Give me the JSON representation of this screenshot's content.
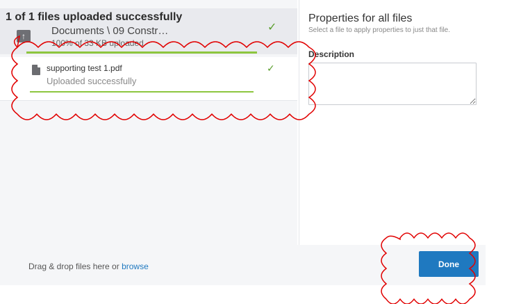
{
  "upload": {
    "title": "1 of 1 files uploaded successfully",
    "folder_path": "Documents \\ 09 Constr…",
    "progress_text": "100% of 33 KB uploaded",
    "check_icon": "✓"
  },
  "file": {
    "name": "supporting test 1.pdf",
    "status": "Uploaded successfully",
    "check_icon": "✓"
  },
  "properties": {
    "title": "Properties for all files",
    "subtitle": "Select a file to apply properties to just that file.",
    "description_label": "Description",
    "description_value": ""
  },
  "footer": {
    "drop_text": "Drag & drop files here or ",
    "browse_label": "browse",
    "done_label": "Done"
  },
  "colors": {
    "accent": "#1f79c0",
    "success": "#8dc63f",
    "annotation": "#e10000"
  }
}
